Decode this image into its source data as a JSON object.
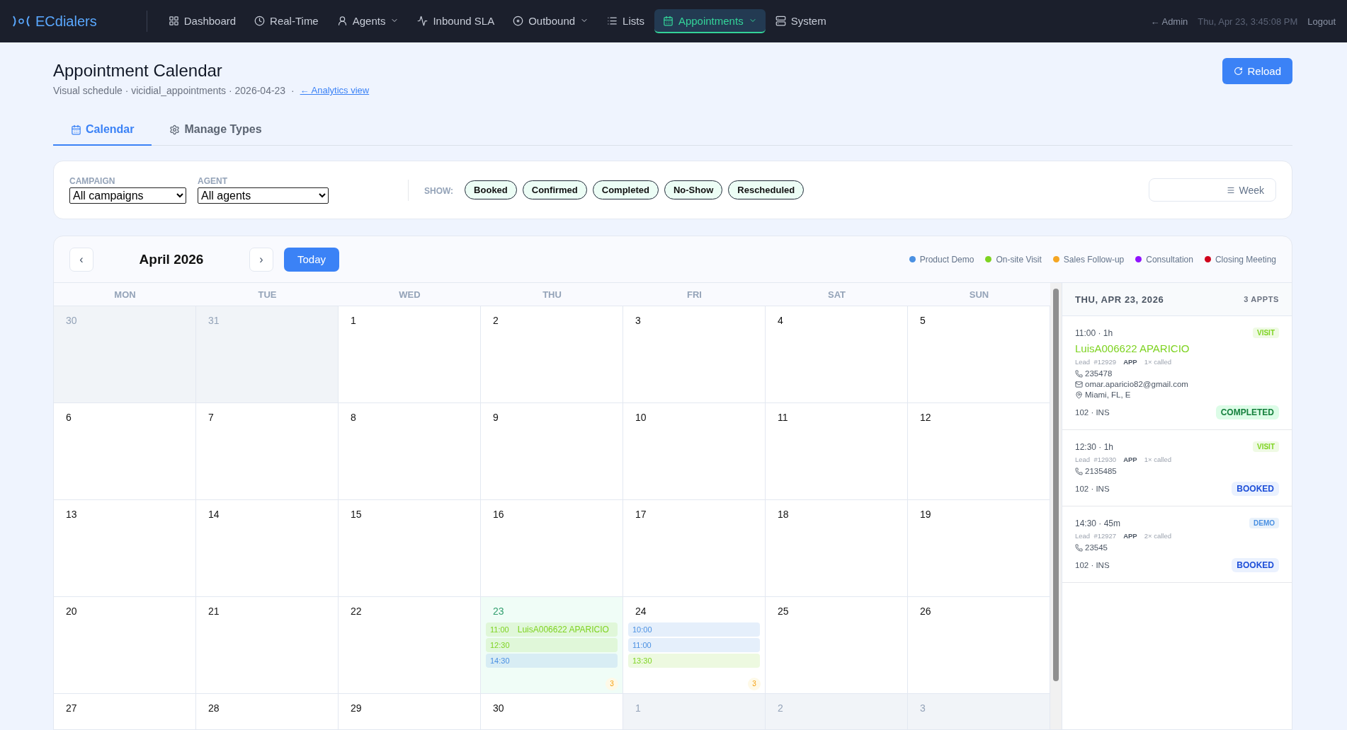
{
  "nav": {
    "brand": "ECdialers",
    "items": [
      {
        "label": "Dashboard",
        "selected": false,
        "dropdown": false
      },
      {
        "label": "Real-Time",
        "selected": false,
        "dropdown": false
      },
      {
        "label": "Agents",
        "selected": false,
        "dropdown": true
      },
      {
        "label": "Inbound SLA",
        "selected": false,
        "dropdown": false
      },
      {
        "label": "Outbound",
        "selected": false,
        "dropdown": true
      },
      {
        "label": "Lists",
        "selected": false,
        "dropdown": false
      },
      {
        "label": "Appointments",
        "selected": true,
        "dropdown": true
      },
      {
        "label": "System",
        "selected": false,
        "dropdown": false
      }
    ],
    "user": "← Admin",
    "clock": "Thu, Apr 23, 3:45:08 PM",
    "logout": "Logout"
  },
  "header": {
    "title": "Appointment Calendar",
    "subtitle": "Visual schedule · vicidial_appointments · 2026-04-23  ·",
    "link": "← Analytics view",
    "reload": "Reload"
  },
  "tabs": [
    {
      "label": "Calendar",
      "selected": true
    },
    {
      "label": "Manage Types",
      "selected": false
    }
  ],
  "filters": {
    "campaign_label": "CAMPAIGN",
    "campaign_value": "All campaigns",
    "agent_label": "AGENT",
    "agent_value": "All agents",
    "show_label": "SHOW:",
    "chips": [
      {
        "label": "Booked",
        "selected": true
      },
      {
        "label": "Confirmed",
        "selected": true
      },
      {
        "label": "Completed",
        "selected": true
      },
      {
        "label": "No-Show",
        "selected": true
      },
      {
        "label": "Rescheduled",
        "selected": true
      }
    ],
    "view": "Week"
  },
  "calendar": {
    "month": "April 2026",
    "prev": "‹",
    "next": "›",
    "today": "Today",
    "legend": [
      {
        "label": "Product Demo",
        "color": "#4a90e2"
      },
      {
        "label": "On-site Visit",
        "color": "#7ed321"
      },
      {
        "label": "Sales Follow-up",
        "color": "#f5a623"
      },
      {
        "label": "Consultation",
        "color": "#9013fe"
      },
      {
        "label": "Closing Meeting",
        "color": "#d0021b"
      }
    ],
    "weekdays": [
      "MON",
      "TUE",
      "WED",
      "THU",
      "FRI",
      "SAT",
      "SUN"
    ],
    "weeks": [
      [
        {
          "day": "30",
          "in_month": false,
          "today": false
        },
        {
          "day": "31",
          "in_month": false,
          "today": false
        },
        {
          "day": "1",
          "in_month": true,
          "today": false
        },
        {
          "day": "2",
          "in_month": true,
          "today": false
        },
        {
          "day": "3",
          "in_month": true,
          "today": false
        },
        {
          "day": "4",
          "in_month": true,
          "today": false
        },
        {
          "day": "5",
          "in_month": true,
          "today": false
        }
      ],
      [
        {
          "day": "6",
          "in_month": true,
          "today": false
        },
        {
          "day": "7",
          "in_month": true,
          "today": false
        },
        {
          "day": "8",
          "in_month": true,
          "today": false
        },
        {
          "day": "9",
          "in_month": true,
          "today": false
        },
        {
          "day": "10",
          "in_month": true,
          "today": false
        },
        {
          "day": "11",
          "in_month": true,
          "today": false
        },
        {
          "day": "12",
          "in_month": true,
          "today": false
        }
      ],
      [
        {
          "day": "13",
          "in_month": true,
          "today": false
        },
        {
          "day": "14",
          "in_month": true,
          "today": false
        },
        {
          "day": "15",
          "in_month": true,
          "today": false
        },
        {
          "day": "16",
          "in_month": true,
          "today": false
        },
        {
          "day": "17",
          "in_month": true,
          "today": false
        },
        {
          "day": "18",
          "in_month": true,
          "today": false
        },
        {
          "day": "19",
          "in_month": true,
          "today": false
        }
      ],
      [
        {
          "day": "20",
          "in_month": true,
          "today": false
        },
        {
          "day": "21",
          "in_month": true,
          "today": false
        },
        {
          "day": "22",
          "in_month": true,
          "today": false
        },
        {
          "day": "23",
          "in_month": true,
          "today": true,
          "count": "3",
          "events": [
            {
              "time": "11:00",
              "name": "LuisA006622 APARICIO",
              "color": "#7ed321"
            },
            {
              "time": "12:30",
              "color": "#7ed321"
            },
            {
              "time": "14:30",
              "color": "#4a90e2"
            }
          ]
        },
        {
          "day": "24",
          "in_month": true,
          "today": false,
          "count": "3",
          "events": [
            {
              "time": "10:00",
              "color": "#4a90e2"
            },
            {
              "time": "11:00",
              "color": "#4a90e2"
            },
            {
              "time": "13:30",
              "color": "#7ed321"
            }
          ]
        },
        {
          "day": "25",
          "in_month": true,
          "today": false
        },
        {
          "day": "26",
          "in_month": true,
          "today": false
        }
      ],
      [
        {
          "day": "27",
          "in_month": true,
          "today": false
        },
        {
          "day": "28",
          "in_month": true,
          "today": false
        },
        {
          "day": "29",
          "in_month": true,
          "today": false
        },
        {
          "day": "30",
          "in_month": true,
          "today": false
        },
        {
          "day": "1",
          "in_month": false,
          "today": false
        },
        {
          "day": "2",
          "in_month": false,
          "today": false
        },
        {
          "day": "3",
          "in_month": false,
          "today": false
        }
      ]
    ]
  },
  "day_panel": {
    "date": "THU, APR 23, 2026",
    "count": "3 APPTS",
    "appointments": [
      {
        "time": "11:00 · 1h",
        "tag": "VISIT",
        "color": "#7ed321",
        "name": "LuisA006622 APARICIO",
        "lead": "Lead  #12929",
        "source": "APP",
        "calls": "1× called",
        "phone": "235478",
        "email": "omar.aparicio82@gmail.com",
        "location": "Miami, FL, E",
        "agent": "102 · INS",
        "status": "COMPLETED",
        "kind": "completed"
      },
      {
        "time": "12:30 · 1h",
        "tag": "VISIT",
        "color": "#7ed321",
        "lead": "Lead  #12930",
        "source": "APP",
        "calls": "1× called",
        "phone": "2135485",
        "agent": "102 · INS",
        "status": "BOOKED",
        "kind": "booked"
      },
      {
        "time": "14:30 · 45m",
        "tag": "DEMO",
        "color": "#4a90e2",
        "lead": "Lead  #12927",
        "source": "APP",
        "calls": "2× called",
        "phone": "23545",
        "agent": "102 · INS",
        "status": "BOOKED",
        "kind": "booked"
      }
    ]
  }
}
